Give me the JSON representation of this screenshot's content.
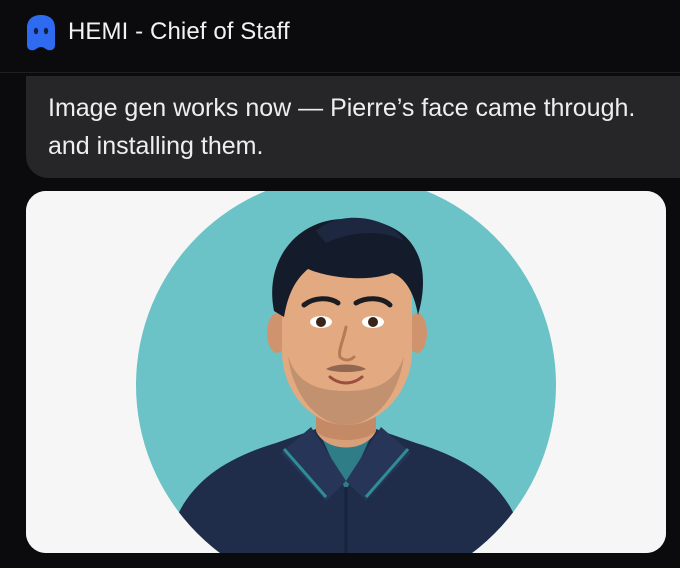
{
  "header": {
    "avatar_icon": "ghost-icon",
    "title": "HEMI - Chief of Staff",
    "avatar_color": "#2f6bf0"
  },
  "message": {
    "line1": "Image gen works now — Pierre’s face came through.",
    "line2": "and installing them."
  },
  "image": {
    "icon": "portrait-image",
    "background_color": "#6cc3c7",
    "card_color": "#f6f6f6"
  }
}
